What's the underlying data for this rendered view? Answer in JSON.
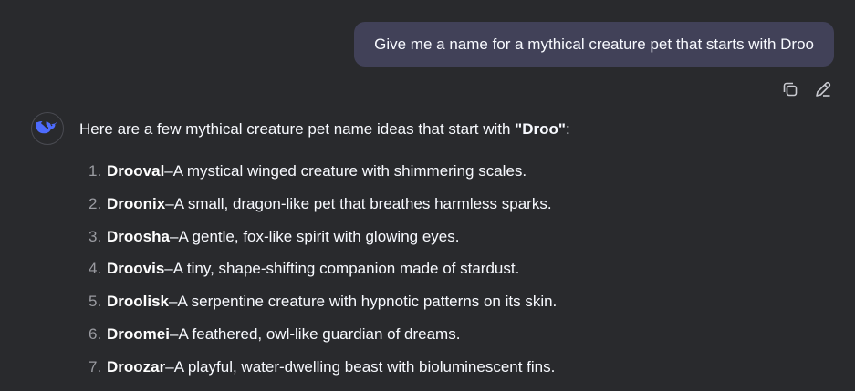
{
  "user_message": {
    "text": "Give me a name for a mythical creature pet that starts with Droo"
  },
  "message_actions": {
    "copy_icon": "copy-icon",
    "edit_icon": "edit-pencil-icon"
  },
  "assistant": {
    "avatar_icon": "whale-logo-icon",
    "intro_prefix": "Here are a few mythical creature pet name ideas that start with ",
    "intro_bold": "\"Droo\"",
    "intro_suffix": ":",
    "items": [
      {
        "num": "1.",
        "name": "Drooval",
        "sep": " – ",
        "desc": "A mystical winged creature with shimmering scales."
      },
      {
        "num": "2.",
        "name": "Droonix",
        "sep": " – ",
        "desc": "A small, dragon-like pet that breathes harmless sparks."
      },
      {
        "num": "3.",
        "name": "Droosha",
        "sep": " – ",
        "desc": "A gentle, fox-like spirit with glowing eyes."
      },
      {
        "num": "4.",
        "name": "Droovis",
        "sep": " – ",
        "desc": "A tiny, shape-shifting companion made of stardust."
      },
      {
        "num": "5.",
        "name": "Droolisk",
        "sep": " – ",
        "desc": "A serpentine creature with hypnotic patterns on its skin."
      },
      {
        "num": "6.",
        "name": "Droomei",
        "sep": " – ",
        "desc": "A feathered, owl-like guardian of dreams."
      },
      {
        "num": "7.",
        "name": "Droozar",
        "sep": " – ",
        "desc": "A playful, water-dwelling beast with bioluminescent fins."
      }
    ]
  }
}
